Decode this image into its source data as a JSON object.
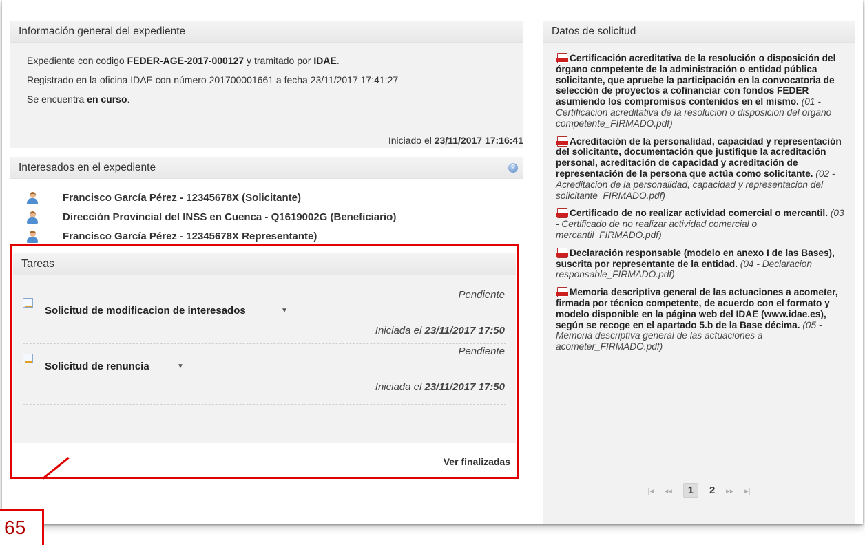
{
  "info": {
    "header": "Información general del expediente",
    "line1_prefix": "Expediente con codigo ",
    "line1_code": "FEDER-AGE-2017-000127",
    "line1_mid": " y tramitado por ",
    "line1_org": "IDAE",
    "line1_end": ".",
    "line2": "Registrado en la oficina IDAE con número 201700001661 a fecha 23/11/2017 17:41:27",
    "line3_prefix": "Se encuentra ",
    "line3_status": "en curso",
    "line3_end": ".",
    "started_prefix": "Iniciado el ",
    "started_date": "23/11/2017 17:16:41"
  },
  "interesados": {
    "header": "Interesados en el expediente",
    "help_glyph": "?",
    "people": [
      {
        "label": "Francisco García Pérez - 12345678X  (Solicitante)"
      },
      {
        "label": "Dirección Provincial del INSS en Cuenca - Q1619002G (Beneficiario)"
      },
      {
        "label": "Francisco García Pérez - 12345678X Representante)"
      }
    ]
  },
  "tareas": {
    "header": "Tareas",
    "items": [
      {
        "title": "Solicitud de modificacion de interesados",
        "status": "Pendiente",
        "date_prefix": "Iniciada el ",
        "date": "23/11/2017 17:50"
      },
      {
        "title": "Solicitud de renuncia",
        "status": "Pendiente",
        "date_prefix": "Iniciada el ",
        "date": "23/11/2017 17:50"
      }
    ],
    "ver_finalizadas": "Ver finalizadas",
    "caret": "▼"
  },
  "callout": {
    "number": "65",
    "color": "#e00000"
  },
  "datos": {
    "header": "Datos de solicitud",
    "docs": [
      {
        "bold": "Certificación acreditativa de la resolución o disposición del órgano competente de la administración o entidad pública solicitante, que apruebe la participación en la convocatoria de selección de proyectos a cofinanciar con fondos FEDER asumiendo los compromisos contenidos en el mismo.",
        "file": "(01 - Certificacion acreditativa de la resolucion o disposicion del organo competente_FIRMADO.pdf)"
      },
      {
        "bold": "Acreditación de la personalidad, capacidad y representación del solicitante, documentación que justifique la acreditación personal, acreditación de capacidad y acreditación de representación de la persona que actúa como solicitante.",
        "file": "(02 - Acreditacion de la personalidad, capacidad y representacion del solicitante_FIRMADO.pdf)"
      },
      {
        "bold": "Certificado de no realizar actividad comercial o mercantil.",
        "file": "(03 - Certificado de no realizar actividad comercial o mercantil_FIRMADO.pdf)"
      },
      {
        "bold": "Declaración responsable (modelo en anexo I de las Bases), suscrita por representante de la entidad.",
        "file": "(04 - Declaracion responsable_FIRMADO.pdf)"
      },
      {
        "bold": "Memoria descriptiva general de las actuaciones a acometer, firmada por técnico competente, de acuerdo con el formato y modelo disponible en la página web del IDAE (www.idae.es), según se recoge en el apartado 5.b de la Base décima.",
        "file": "(05 - Memoria descriptiva general de las actuaciones a acometer_FIRMADO.pdf)"
      }
    ],
    "pager": {
      "first": "|◂",
      "prev": "◂◂",
      "pages": [
        "1",
        "2"
      ],
      "next": "▸▸",
      "last": "▸|"
    }
  }
}
